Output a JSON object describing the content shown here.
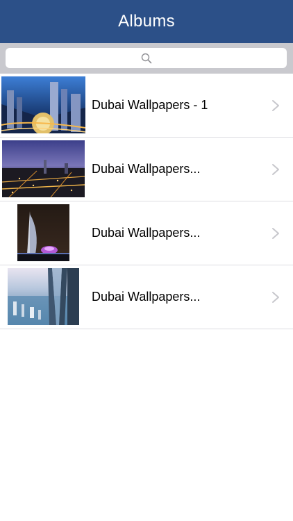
{
  "navbar": {
    "title": "Albums"
  },
  "search": {
    "placeholder": "",
    "value": "",
    "icon": "search-icon"
  },
  "albums": [
    {
      "label": "Dubai Wallpapers - 1",
      "thumbnail": "dubai-towers-night-aerial"
    },
    {
      "label": "Dubai Wallpapers...",
      "thumbnail": "dubai-city-dusk-panorama"
    },
    {
      "label": "Dubai Wallpapers...",
      "thumbnail": "burj-al-arab-night"
    },
    {
      "label": "Dubai Wallpapers...",
      "thumbnail": "burj-khalifa-view-down"
    }
  ],
  "colors": {
    "navbar": "#2c5088",
    "search_bar_bg": "#c9c9ce",
    "separator": "#dcdce0",
    "chevron": "#c7c7cc"
  }
}
